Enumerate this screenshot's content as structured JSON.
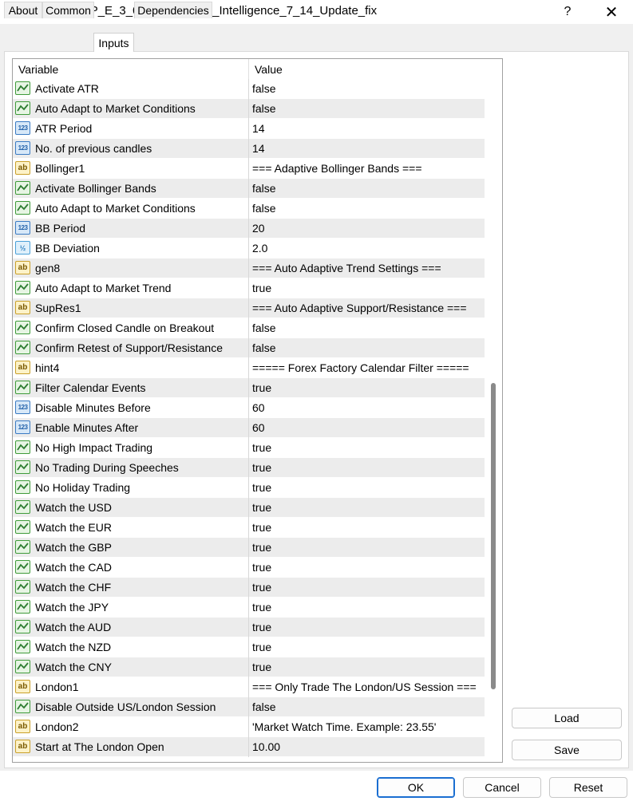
{
  "window": {
    "title": "Expert - H_I_A_P_E_3_0_A_I_Artificial_Intelligence_7_14_Update_fix",
    "help_glyph": "?",
    "close_glyph": "✕"
  },
  "tabs": [
    {
      "label": "About",
      "active": false
    },
    {
      "label": "Common",
      "active": false
    },
    {
      "label": "Inputs",
      "active": true
    },
    {
      "label": "Dependencies",
      "active": false
    }
  ],
  "grid": {
    "headers": {
      "variable": "Variable",
      "value": "Value"
    },
    "rows": [
      {
        "type": "bool",
        "variable": "Activate ATR",
        "value": "false"
      },
      {
        "type": "bool",
        "variable": "Auto Adapt to Market Conditions",
        "value": "false"
      },
      {
        "type": "int",
        "variable": "ATR Period",
        "value": "14"
      },
      {
        "type": "int",
        "variable": "No. of previous candles",
        "value": "14"
      },
      {
        "type": "string",
        "variable": "Bollinger1",
        "value": "=== Adaptive Bollinger Bands ==="
      },
      {
        "type": "bool",
        "variable": "Activate Bollinger Bands",
        "value": "false"
      },
      {
        "type": "bool",
        "variable": "Auto Adapt to Market Conditions",
        "value": "false"
      },
      {
        "type": "int",
        "variable": "BB Period",
        "value": "20"
      },
      {
        "type": "double",
        "variable": "BB Deviation",
        "value": "2.0"
      },
      {
        "type": "string",
        "variable": "gen8",
        "value": "=== Auto Adaptive Trend Settings ==="
      },
      {
        "type": "bool",
        "variable": "Auto Adapt to Market Trend",
        "value": "true"
      },
      {
        "type": "string",
        "variable": "SupRes1",
        "value": "=== Auto Adaptive Support/Resistance ==="
      },
      {
        "type": "bool",
        "variable": "Confirm Closed Candle on Breakout",
        "value": "false"
      },
      {
        "type": "bool",
        "variable": "Confirm Retest of Support/Resistance",
        "value": "false"
      },
      {
        "type": "string",
        "variable": "hint4",
        "value": "===== Forex Factory Calendar Filter ====="
      },
      {
        "type": "bool",
        "variable": "Filter Calendar Events",
        "value": "true"
      },
      {
        "type": "int",
        "variable": "Disable Minutes Before",
        "value": "60"
      },
      {
        "type": "int",
        "variable": "Enable Minutes After",
        "value": "60"
      },
      {
        "type": "bool",
        "variable": "No High Impact Trading",
        "value": "true"
      },
      {
        "type": "bool",
        "variable": "No Trading During Speeches",
        "value": "true"
      },
      {
        "type": "bool",
        "variable": "No Holiday Trading",
        "value": "true"
      },
      {
        "type": "bool",
        "variable": "Watch the USD",
        "value": "true"
      },
      {
        "type": "bool",
        "variable": "Watch the EUR",
        "value": "true"
      },
      {
        "type": "bool",
        "variable": "Watch the GBP",
        "value": "true"
      },
      {
        "type": "bool",
        "variable": "Watch the CAD",
        "value": "true"
      },
      {
        "type": "bool",
        "variable": "Watch the CHF",
        "value": "true"
      },
      {
        "type": "bool",
        "variable": "Watch the JPY",
        "value": "true"
      },
      {
        "type": "bool",
        "variable": "Watch the AUD",
        "value": "true"
      },
      {
        "type": "bool",
        "variable": "Watch the NZD",
        "value": "true"
      },
      {
        "type": "bool",
        "variable": "Watch the CNY",
        "value": "true"
      },
      {
        "type": "string",
        "variable": "London1",
        "value": "=== Only Trade The London/US Session ==="
      },
      {
        "type": "bool",
        "variable": "Disable Outside US/London Session",
        "value": "false"
      },
      {
        "type": "string",
        "variable": "London2",
        "value": "'Market Watch Time. Example: 23.55'"
      },
      {
        "type": "string",
        "variable": "Start at The London Open",
        "value": "10.00"
      }
    ]
  },
  "icons": {
    "bool": "bool-icon",
    "int": "integer-icon",
    "double": "double-icon",
    "string": "string-icon",
    "int_text": "123",
    "double_text": "½",
    "string_text": "ab"
  },
  "side_buttons": {
    "load": "Load",
    "save": "Save"
  },
  "footer_buttons": {
    "ok": "OK",
    "cancel": "Cancel",
    "reset": "Reset"
  }
}
